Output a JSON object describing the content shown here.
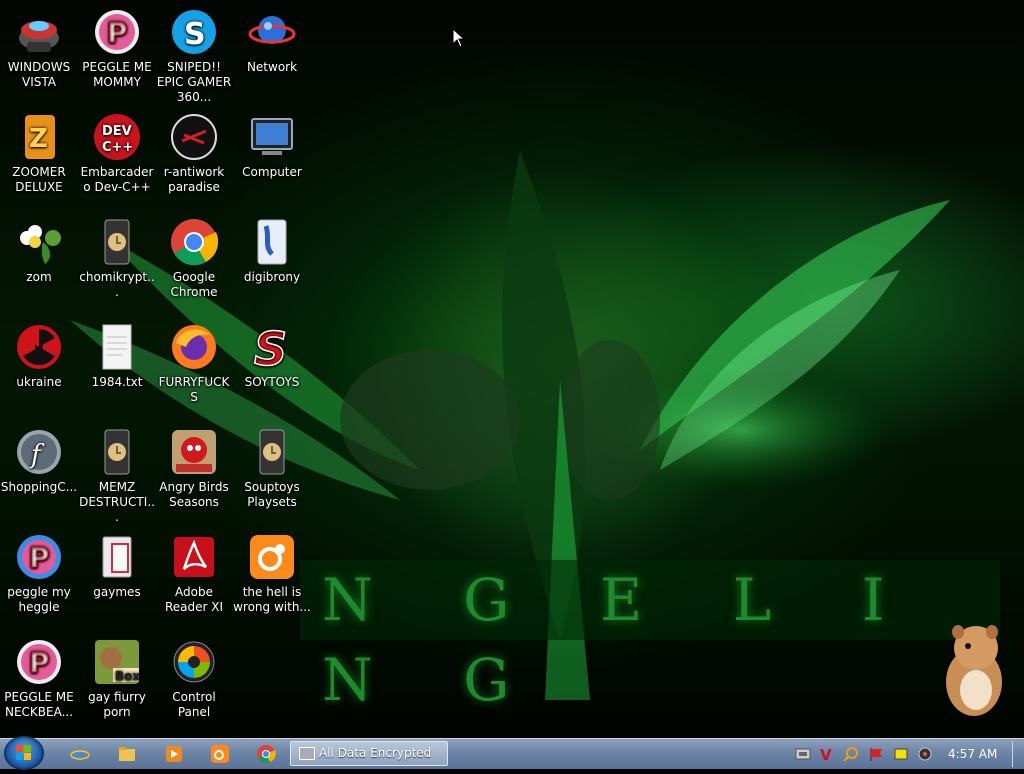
{
  "desktop": {
    "wallpaper_text": "N G E L I N G",
    "icons": [
      {
        "label": "WINDOWS VISTA",
        "icon": "vista-bowl-icon"
      },
      {
        "label": "PEGGLE ME MOMMY",
        "icon": "peggle-icon"
      },
      {
        "label": "SNIPED!! EPIC GAMER 360...",
        "icon": "skype-icon"
      },
      {
        "label": "Network",
        "icon": "network-globe-icon"
      },
      {
        "label": "ZOOMER DELUXE",
        "icon": "zoomer-icon"
      },
      {
        "label": "Embarcadero Dev-C++",
        "icon": "devcpp-icon"
      },
      {
        "label": "r-antiwork paradise",
        "icon": "antiwork-icon"
      },
      {
        "label": "Computer",
        "icon": "computer-icon"
      },
      {
        "label": "zom",
        "icon": "flower-icon"
      },
      {
        "label": "chomikrypt...",
        "icon": "file-lock-icon"
      },
      {
        "label": "Google Chrome",
        "icon": "chrome-icon"
      },
      {
        "label": "digibrony",
        "icon": "digibrony-icon"
      },
      {
        "label": "ukraine",
        "icon": "radiation-icon"
      },
      {
        "label": "1984.txt",
        "icon": "text-file-icon"
      },
      {
        "label": "FURRYFUCKS",
        "icon": "firefox-icon"
      },
      {
        "label": "SOYTOYS",
        "icon": "soytoys-icon"
      },
      {
        "label": "ShoppingC...",
        "icon": "flash-icon"
      },
      {
        "label": "MEMZ DESTRUCTI...",
        "icon": "file-lock-icon"
      },
      {
        "label": "Angry Birds Seasons",
        "icon": "angry-birds-icon"
      },
      {
        "label": "Souptoys Playsets",
        "icon": "file-lock-icon"
      },
      {
        "label": "peggle my heggle",
        "icon": "peggle-icon"
      },
      {
        "label": "gaymes",
        "icon": "folder-icon"
      },
      {
        "label": "Adobe Reader XI",
        "icon": "adobe-reader-icon"
      },
      {
        "label": "the hell is wrong with...",
        "icon": "uc-browser-icon"
      },
      {
        "label": "PEGGLE ME NECKBEA...",
        "icon": "peggle-icon"
      },
      {
        "label": "gay fiurry porn",
        "icon": "box-icon"
      },
      {
        "label": "Control Panel",
        "icon": "control-panel-icon"
      }
    ]
  },
  "taskbar": {
    "open_window": "All Data Encrypted",
    "clock": "4:57 AM"
  }
}
